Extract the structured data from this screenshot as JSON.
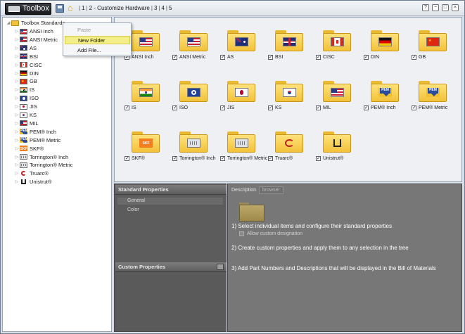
{
  "titlebar": {
    "app_name": "Toolbox",
    "breadcrumb": [
      "1",
      "2 - Customize Hardware",
      "3",
      "4",
      "5"
    ],
    "controls": [
      "?",
      "−",
      "□",
      "×"
    ]
  },
  "tree": {
    "root_label": "Toolbox Standards",
    "items": [
      {
        "label": "ANSI Inch",
        "icon": "us-flag-icon"
      },
      {
        "label": "ANSI Metric",
        "icon": "us-flag-icon"
      },
      {
        "label": "AS",
        "icon": "australia-flag-icon"
      },
      {
        "label": "BSI",
        "icon": "uk-flag-icon"
      },
      {
        "label": "CISC",
        "icon": "canada-flag-icon"
      },
      {
        "label": "DIN",
        "icon": "germany-flag-icon"
      },
      {
        "label": "GB",
        "icon": "china-flag-icon"
      },
      {
        "label": "IS",
        "icon": "india-flag-icon"
      },
      {
        "label": "ISO",
        "icon": "iso-icon"
      },
      {
        "label": "JIS",
        "icon": "japan-flag-icon"
      },
      {
        "label": "KS",
        "icon": "korea-flag-icon"
      },
      {
        "label": "MIL",
        "icon": "us-flag-icon"
      },
      {
        "label": "PEM® Inch",
        "icon": "pem-icon"
      },
      {
        "label": "PEM® Metric",
        "icon": "pem-icon"
      },
      {
        "label": "SKF®",
        "icon": "skf-icon"
      },
      {
        "label": "Torrington® Inch",
        "icon": "torrington-icon"
      },
      {
        "label": "Torrington® Metric",
        "icon": "torrington-icon"
      },
      {
        "label": "Truarc®",
        "icon": "truarc-icon"
      },
      {
        "label": "Unistrut®",
        "icon": "unistrut-icon"
      }
    ]
  },
  "context_menu": {
    "items": [
      {
        "label": "Paste",
        "state": "disabled"
      },
      {
        "label": "New Folder",
        "state": "highlighted"
      },
      {
        "label": "Add File...",
        "state": "normal"
      }
    ]
  },
  "cards": [
    {
      "label": "ANSI Inch",
      "checked": true,
      "icon": "us-flag-icon"
    },
    {
      "label": "ANSI Metric",
      "checked": true,
      "icon": "us-flag-icon"
    },
    {
      "label": "AS",
      "checked": true,
      "icon": "australia-flag-icon"
    },
    {
      "label": "BSI",
      "checked": true,
      "icon": "uk-flag-icon"
    },
    {
      "label": "CISC",
      "checked": true,
      "icon": "canada-flag-icon"
    },
    {
      "label": "DIN",
      "checked": true,
      "icon": "germany-flag-icon"
    },
    {
      "label": "GB",
      "checked": true,
      "icon": "china-flag-icon"
    },
    {
      "label": "IS",
      "checked": true,
      "icon": "india-flag-icon"
    },
    {
      "label": "ISO",
      "checked": true,
      "icon": "iso-icon"
    },
    {
      "label": "JIS",
      "checked": true,
      "icon": "japan-flag-icon"
    },
    {
      "label": "KS",
      "checked": true,
      "icon": "korea-flag-icon"
    },
    {
      "label": "MIL",
      "checked": true,
      "icon": "us-flag-icon"
    },
    {
      "label": "PEM® Inch",
      "checked": true,
      "icon": "pem-icon"
    },
    {
      "label": "PEM® Metric",
      "checked": true,
      "icon": "pem-icon"
    },
    {
      "label": "SKF®",
      "checked": true,
      "icon": "skf-icon"
    },
    {
      "label": "Torrington® Inch",
      "checked": true,
      "icon": "torrington-icon"
    },
    {
      "label": "Torrington® Metric",
      "checked": true,
      "icon": "torrington-icon"
    },
    {
      "label": "Truarc®",
      "checked": true,
      "icon": "truarc-icon"
    },
    {
      "label": "Unistrut®",
      "checked": true,
      "icon": "unistrut-icon"
    }
  ],
  "standard_properties": {
    "title": "Standard Properties",
    "items": [
      "General",
      "Color"
    ]
  },
  "custom_properties": {
    "title": "Custom Properties"
  },
  "description": {
    "label": "Description",
    "browser_tab": "browser",
    "step1": "1) Select individual items and configure their standard properties",
    "allow_custom": "Allow custom designation",
    "step2": "2) Create custom properties and apply them to any selection in the tree",
    "step3": "3) Add Part Numbers and Descriptions that will be displayed in the Bill of Materials"
  },
  "colors": {
    "folder": "#f2c23a",
    "highlight": "#f4ee8a",
    "dark_panel": "#5c5c5c"
  }
}
